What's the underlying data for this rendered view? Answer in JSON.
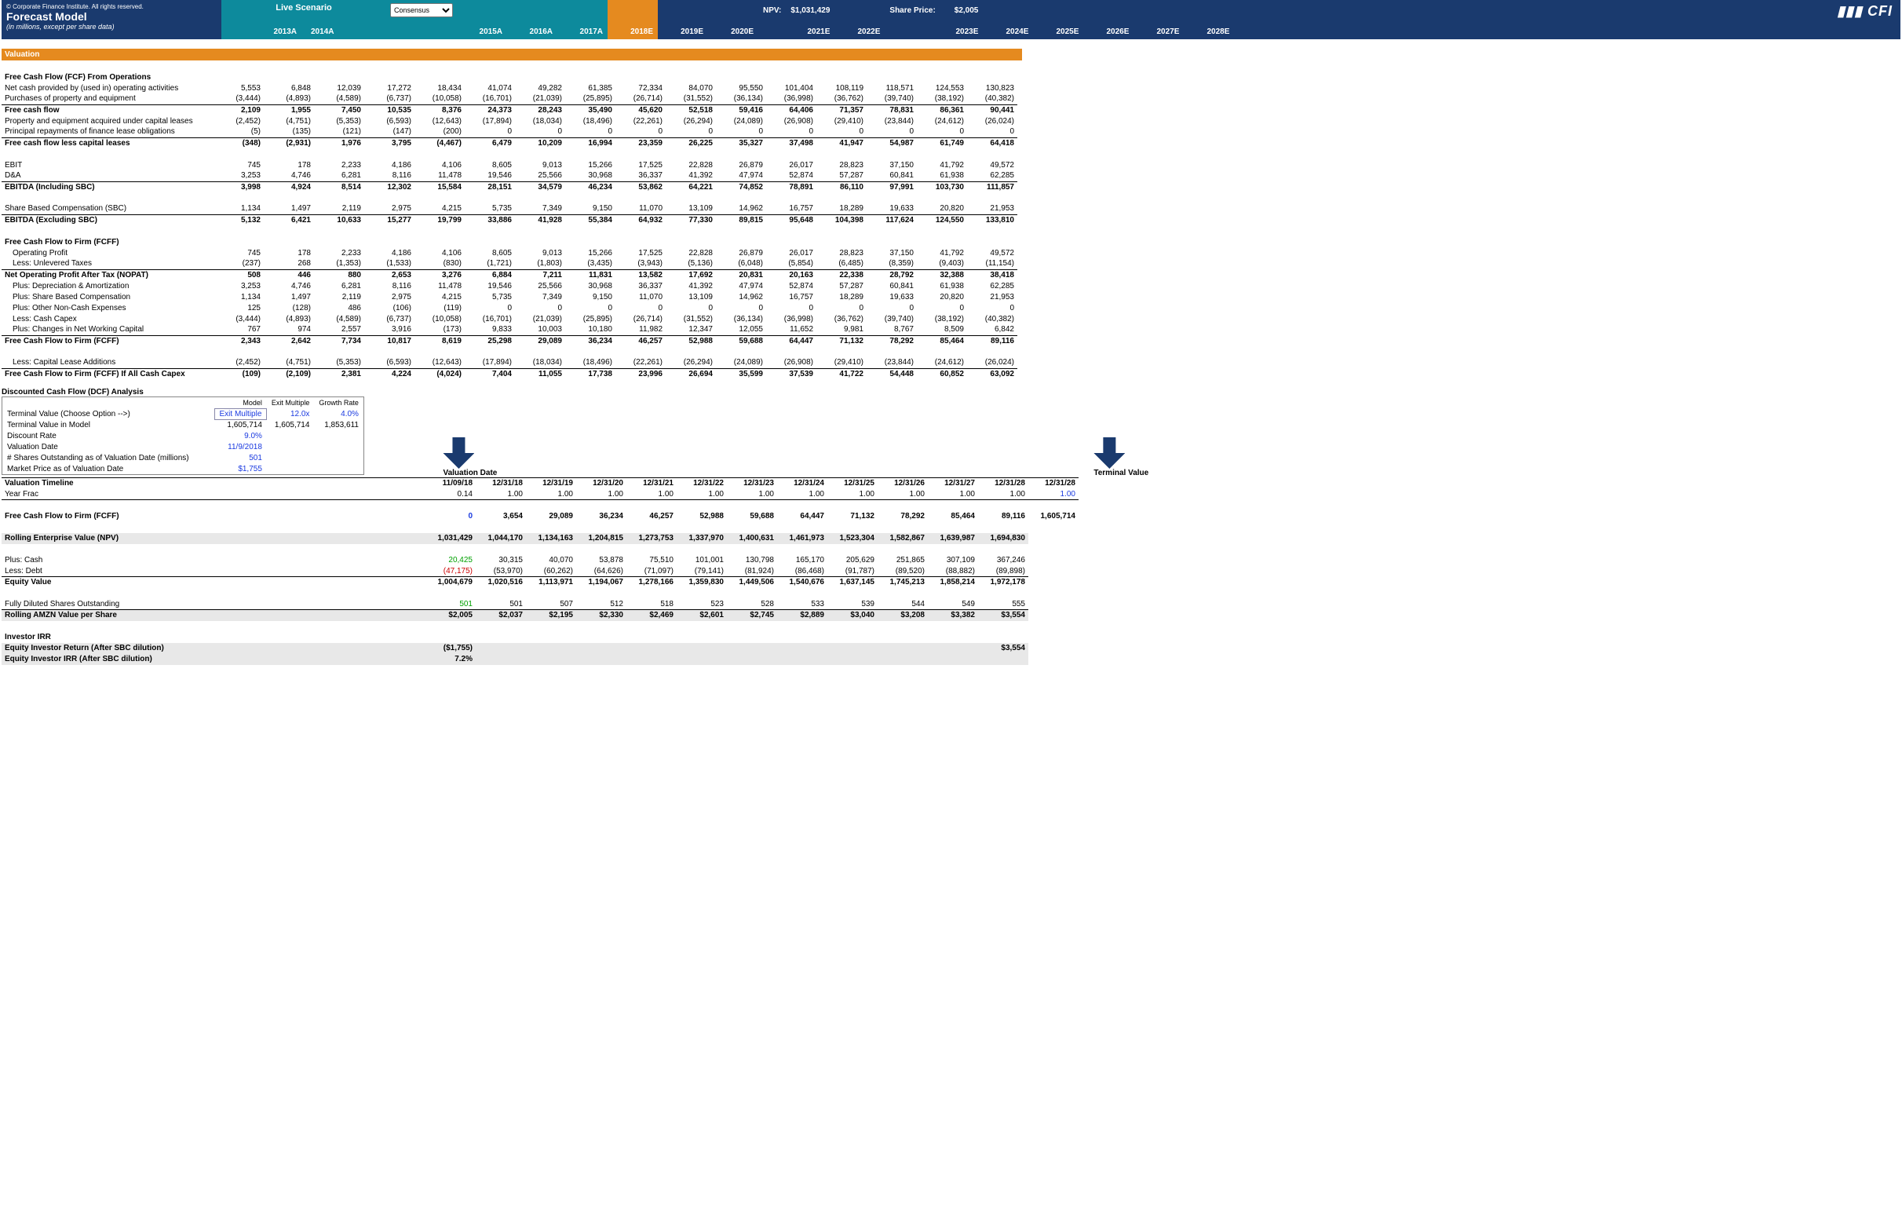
{
  "header": {
    "copyright": "© Corporate Finance Institute. All rights reserved.",
    "title": "Forecast Model",
    "subtitle": "(in millions, except per share data)",
    "scenario_label": "Live Scenario",
    "dropdown": "Consensus",
    "npv_label": "NPV:",
    "npv_value": "$1,031,429",
    "sp_label": "Share Price:",
    "sp_value": "$2,005",
    "logo": "▮▮▮ CFI",
    "years": [
      "2013A",
      "2014A",
      "2015A",
      "2016A",
      "2017A",
      "2018E",
      "2019E",
      "2020E",
      "2021E",
      "2022E",
      "2023E",
      "2024E",
      "2025E",
      "2026E",
      "2027E",
      "2028E"
    ]
  },
  "sections": {
    "valuation": "Valuation",
    "fcf": "Free Cash Flow (FCF) From Operations",
    "fcff": "Free Cash Flow to Firm (FCFF)",
    "dcf": "Discounted Cash Flow (DCF) Analysis",
    "timeline": "Valuation Timeline",
    "irr": "Investor IRR"
  },
  "rows": {
    "ncp": [
      "Net cash provided by (used in) operating activities",
      "5,553",
      "6,848",
      "12,039",
      "17,272",
      "18,434",
      "41,074",
      "49,282",
      "61,385",
      "72,334",
      "84,070",
      "95,550",
      "101,404",
      "108,119",
      "118,571",
      "124,553",
      "130,823"
    ],
    "ppe": [
      "Purchases of property and equipment",
      "(3,444)",
      "(4,893)",
      "(4,589)",
      "(6,737)",
      "(10,058)",
      "(16,701)",
      "(21,039)",
      "(25,895)",
      "(26,714)",
      "(31,552)",
      "(36,134)",
      "(36,998)",
      "(36,762)",
      "(39,740)",
      "(38,192)",
      "(40,382)"
    ],
    "fcf": [
      "Free cash flow",
      "2,109",
      "1,955",
      "7,450",
      "10,535",
      "8,376",
      "24,373",
      "28,243",
      "35,490",
      "45,620",
      "52,518",
      "59,416",
      "64,406",
      "71,357",
      "78,831",
      "86,361",
      "90,441"
    ],
    "pea": [
      "Property and equipment acquired under capital leases",
      "(2,452)",
      "(4,751)",
      "(5,353)",
      "(6,593)",
      "(12,643)",
      "(17,894)",
      "(18,034)",
      "(18,496)",
      "(22,261)",
      "(26,294)",
      "(24,089)",
      "(26,908)",
      "(29,410)",
      "(23,844)",
      "(24,612)",
      "(26,024)"
    ],
    "prfl": [
      "Principal repayments of finance lease obligations",
      "(5)",
      "(135)",
      "(121)",
      "(147)",
      "(200)",
      "0",
      "0",
      "0",
      "0",
      "0",
      "0",
      "0",
      "0",
      "0",
      "0",
      "0"
    ],
    "fcfl": [
      "Free cash flow less capital leases",
      "(348)",
      "(2,931)",
      "1,976",
      "3,795",
      "(4,467)",
      "6,479",
      "10,209",
      "16,994",
      "23,359",
      "26,225",
      "35,327",
      "37,498",
      "41,947",
      "54,987",
      "61,749",
      "64,418"
    ],
    "ebit": [
      "EBIT",
      "745",
      "178",
      "2,233",
      "4,186",
      "4,106",
      "8,605",
      "9,013",
      "15,266",
      "17,525",
      "22,828",
      "26,879",
      "26,017",
      "28,823",
      "37,150",
      "41,792",
      "49,572"
    ],
    "da": [
      "D&A",
      "3,253",
      "4,746",
      "6,281",
      "8,116",
      "11,478",
      "19,546",
      "25,566",
      "30,968",
      "36,337",
      "41,392",
      "47,974",
      "52,874",
      "57,287",
      "60,841",
      "61,938",
      "62,285"
    ],
    "ebinc": [
      "EBITDA (Including SBC)",
      "3,998",
      "4,924",
      "8,514",
      "12,302",
      "15,584",
      "28,151",
      "34,579",
      "46,234",
      "53,862",
      "64,221",
      "74,852",
      "78,891",
      "86,110",
      "97,991",
      "103,730",
      "111,857"
    ],
    "sbc": [
      "Share Based Compensation (SBC)",
      "1,134",
      "1,497",
      "2,119",
      "2,975",
      "4,215",
      "5,735",
      "7,349",
      "9,150",
      "11,070",
      "13,109",
      "14,962",
      "16,757",
      "18,289",
      "19,633",
      "20,820",
      "21,953"
    ],
    "ebex": [
      "EBITDA (Excluding SBC)",
      "5,132",
      "6,421",
      "10,633",
      "15,277",
      "19,799",
      "33,886",
      "41,928",
      "55,384",
      "64,932",
      "77,330",
      "89,815",
      "95,648",
      "104,398",
      "117,624",
      "124,550",
      "133,810"
    ],
    "op": [
      "Operating Profit",
      "745",
      "178",
      "2,233",
      "4,186",
      "4,106",
      "8,605",
      "9,013",
      "15,266",
      "17,525",
      "22,828",
      "26,879",
      "26,017",
      "28,823",
      "37,150",
      "41,792",
      "49,572"
    ],
    "ult": [
      "Less: Unlevered Taxes",
      "(237)",
      "268",
      "(1,353)",
      "(1,533)",
      "(830)",
      "(1,721)",
      "(1,803)",
      "(3,435)",
      "(3,943)",
      "(5,136)",
      "(6,048)",
      "(5,854)",
      "(6,485)",
      "(8,359)",
      "(9,403)",
      "(11,154)"
    ],
    "nopat": [
      "Net Operating Profit After Tax (NOPAT)",
      "508",
      "446",
      "880",
      "2,653",
      "3,276",
      "6,884",
      "7,211",
      "11,831",
      "13,582",
      "17,692",
      "20,831",
      "20,163",
      "22,338",
      "28,792",
      "32,388",
      "38,418"
    ],
    "pda": [
      "Plus: Depreciation & Amortization",
      "3,253",
      "4,746",
      "6,281",
      "8,116",
      "11,478",
      "19,546",
      "25,566",
      "30,968",
      "36,337",
      "41,392",
      "47,974",
      "52,874",
      "57,287",
      "60,841",
      "61,938",
      "62,285"
    ],
    "psbc": [
      "Plus: Share Based Compensation",
      "1,134",
      "1,497",
      "2,119",
      "2,975",
      "4,215",
      "5,735",
      "7,349",
      "9,150",
      "11,070",
      "13,109",
      "14,962",
      "16,757",
      "18,289",
      "19,633",
      "20,820",
      "21,953"
    ],
    "ponc": [
      "Plus: Other Non-Cash Expenses",
      "125",
      "(128)",
      "486",
      "(106)",
      "(119)",
      "0",
      "0",
      "0",
      "0",
      "0",
      "0",
      "0",
      "0",
      "0",
      "0",
      "0"
    ],
    "lcc": [
      "Less: Cash Capex",
      "(3,444)",
      "(4,893)",
      "(4,589)",
      "(6,737)",
      "(10,058)",
      "(16,701)",
      "(21,039)",
      "(25,895)",
      "(26,714)",
      "(31,552)",
      "(36,134)",
      "(36,998)",
      "(36,762)",
      "(39,740)",
      "(38,192)",
      "(40,382)"
    ],
    "pnwc": [
      "Plus: Changes in Net Working Capital",
      "767",
      "974",
      "2,557",
      "3,916",
      "(173)",
      "9,833",
      "10,003",
      "10,180",
      "11,982",
      "12,347",
      "12,055",
      "11,652",
      "9,981",
      "8,767",
      "8,509",
      "6,842"
    ],
    "fcff1": [
      "Free Cash Flow to Firm (FCFF)",
      "2,343",
      "2,642",
      "7,734",
      "10,817",
      "8,619",
      "25,298",
      "29,089",
      "36,234",
      "46,257",
      "52,988",
      "59,688",
      "64,447",
      "71,132",
      "78,292",
      "85,464",
      "89,116"
    ],
    "lcla": [
      "Less: Capital Lease Additions",
      "(2,452)",
      "(4,751)",
      "(5,353)",
      "(6,593)",
      "(12,643)",
      "(17,894)",
      "(18,034)",
      "(18,496)",
      "(22,261)",
      "(26,294)",
      "(24,089)",
      "(26,908)",
      "(29,410)",
      "(23,844)",
      "(24,612)",
      "(26,024)"
    ],
    "fcffac": [
      "Free Cash Flow to Firm (FCFF) If All Cash Capex",
      "(109)",
      "(2,109)",
      "2,381",
      "4,224",
      "(4,024)",
      "7,404",
      "11,055",
      "17,738",
      "23,996",
      "26,694",
      "35,599",
      "37,539",
      "41,722",
      "54,448",
      "60,852",
      "63,092"
    ]
  },
  "dcf": {
    "hdr": [
      "Model",
      "Exit Multiple",
      "Growth Rate"
    ],
    "tv": [
      "Terminal Value (Choose Option -->)",
      "Exit Multiple",
      "12.0x",
      "4.0%"
    ],
    "tvm": [
      "Terminal Value in Model",
      "1,605,714",
      "1,605,714",
      "1,853,611"
    ],
    "dr": [
      "Discount Rate",
      "9.0%"
    ],
    "vd": [
      "Valuation Date",
      "11/9/2018"
    ],
    "sho": [
      "# Shares Outstanding as of Valuation Date (millions)",
      "501"
    ],
    "mp": [
      "Market Price as of Valuation Date",
      "$1,755"
    ],
    "arrow1": "Valuation Date",
    "arrow2": "Terminal Value"
  },
  "timeline": {
    "dates": [
      "11/09/18",
      "12/31/18",
      "12/31/19",
      "12/31/20",
      "12/31/21",
      "12/31/22",
      "12/31/23",
      "12/31/24",
      "12/31/25",
      "12/31/26",
      "12/31/27",
      "12/31/28",
      "12/31/28"
    ],
    "yflbl": "Year Frac",
    "yf": [
      "0.14",
      "1.00",
      "1.00",
      "1.00",
      "1.00",
      "1.00",
      "1.00",
      "1.00",
      "1.00",
      "1.00",
      "1.00",
      "1.00",
      "1.00"
    ],
    "fcff": [
      "Free Cash Flow to Firm (FCFF)",
      "0",
      "3,654",
      "29,089",
      "36,234",
      "46,257",
      "52,988",
      "59,688",
      "64,447",
      "71,132",
      "78,292",
      "85,464",
      "89,116",
      "1,605,714"
    ],
    "rev": [
      "Rolling Enterprise Value (NPV)",
      "1,031,429",
      "1,044,170",
      "1,134,163",
      "1,204,815",
      "1,273,753",
      "1,337,970",
      "1,400,631",
      "1,461,973",
      "1,523,304",
      "1,582,867",
      "1,639,987",
      "1,694,830"
    ],
    "cash": [
      "Plus: Cash",
      "20,425",
      "30,315",
      "40,070",
      "53,878",
      "75,510",
      "101,001",
      "130,798",
      "165,170",
      "205,629",
      "251,865",
      "307,109",
      "367,246"
    ],
    "debt": [
      "Less: Debt",
      "(47,175)",
      "(53,970)",
      "(60,262)",
      "(64,626)",
      "(71,097)",
      "(79,141)",
      "(81,924)",
      "(86,468)",
      "(91,787)",
      "(89,520)",
      "(88,882)",
      "(89,898)"
    ],
    "ev": [
      "Equity Value",
      "1,004,679",
      "1,020,516",
      "1,113,971",
      "1,194,067",
      "1,278,166",
      "1,359,830",
      "1,449,506",
      "1,540,676",
      "1,637,145",
      "1,745,213",
      "1,858,214",
      "1,972,178"
    ],
    "fdso": [
      "Fully Diluted Shares Outstanding",
      "501",
      "501",
      "507",
      "512",
      "518",
      "523",
      "528",
      "533",
      "539",
      "544",
      "549",
      "555"
    ],
    "rps": [
      "Rolling AMZN Value per Share",
      "$2,005",
      "$2,037",
      "$2,195",
      "$2,330",
      "$2,469",
      "$2,601",
      "$2,745",
      "$2,889",
      "$3,040",
      "$3,208",
      "$3,382",
      "$3,554"
    ],
    "eir": [
      "Equity Investor Return (After SBC dilution)",
      "($1,755)",
      "$3,554"
    ],
    "eirr": [
      "Equity Investor IRR (After SBC dilution)",
      "7.2%"
    ]
  }
}
